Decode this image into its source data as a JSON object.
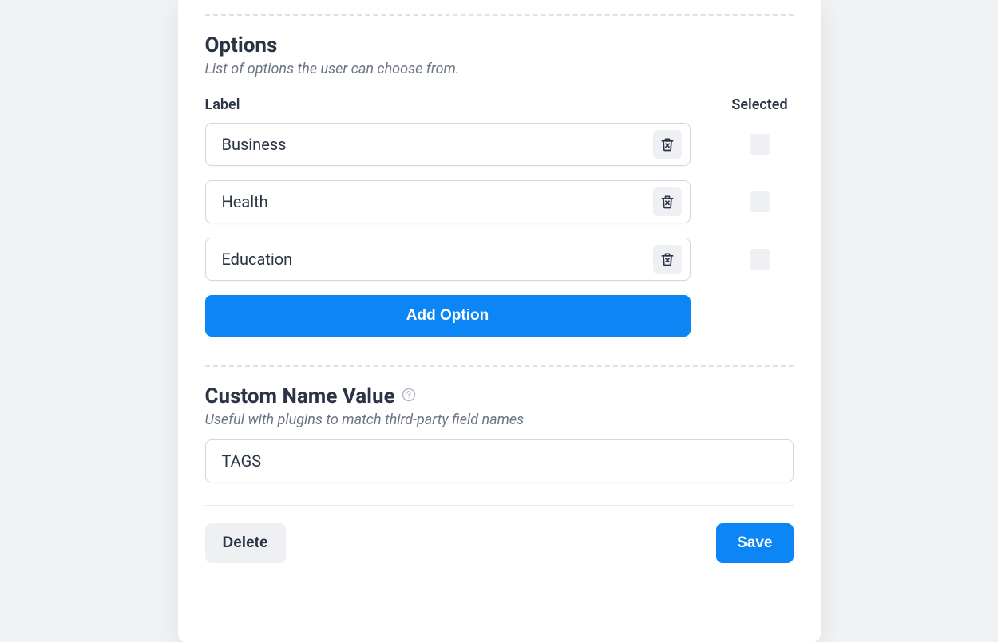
{
  "options_section": {
    "title": "Options",
    "description": "List of options the user can choose from.",
    "label_header": "Label",
    "selected_header": "Selected",
    "items": [
      {
        "label": "Business",
        "selected": false
      },
      {
        "label": "Health",
        "selected": false
      },
      {
        "label": "Education",
        "selected": false
      }
    ],
    "add_button": "Add Option"
  },
  "custom_name_section": {
    "title": "Custom Name Value",
    "description": "Useful with plugins to match third-party field names",
    "value": "TAGS"
  },
  "actions": {
    "delete": "Delete",
    "save": "Save"
  }
}
